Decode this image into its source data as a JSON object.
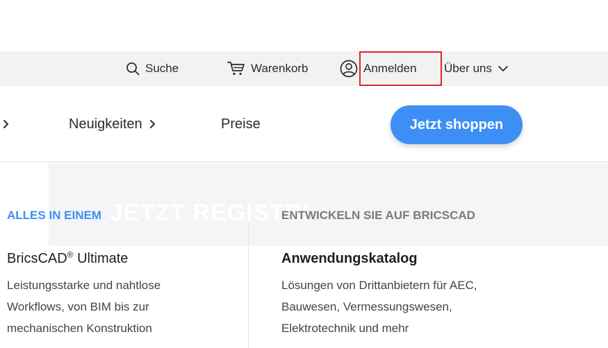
{
  "topbar": {
    "search": {
      "label": "Suche",
      "icon": "search-icon"
    },
    "cart": {
      "label": "Warenkorb",
      "icon": "cart-icon"
    },
    "login": {
      "label": "Anmelden",
      "icon": "user-circle-icon"
    },
    "about": {
      "label": "Über uns",
      "icon": "chevron-down-icon"
    },
    "highlight_color": "#d9262b"
  },
  "nav": {
    "items": [
      {
        "label": "Neuigkeiten"
      },
      {
        "label": "Preise"
      }
    ],
    "cta_label": "Jetzt shoppen",
    "cta_color": "#3d8ff5"
  },
  "banner": {
    "watermark": "JETZT REGISTRI"
  },
  "columns": {
    "left": {
      "eyebrow": "ALLES IN EINEM",
      "title_main": "BricsCAD",
      "title_reg": "®",
      "title_rest": " Ultimate",
      "desc_lines": [
        "Leistungsstarke und nahtlose",
        "Workflows, von BIM bis zur",
        "mechanischen Konstruktion"
      ]
    },
    "right": {
      "eyebrow": "ENTWICKELN SIE AUF BRICSCAD",
      "title": "Anwendungskatalog",
      "desc_lines": [
        "Lösungen von Drittanbietern für AEC,",
        "Bauwesen, Vermessungswesen,",
        "Elektrotechnik und mehr"
      ]
    }
  }
}
